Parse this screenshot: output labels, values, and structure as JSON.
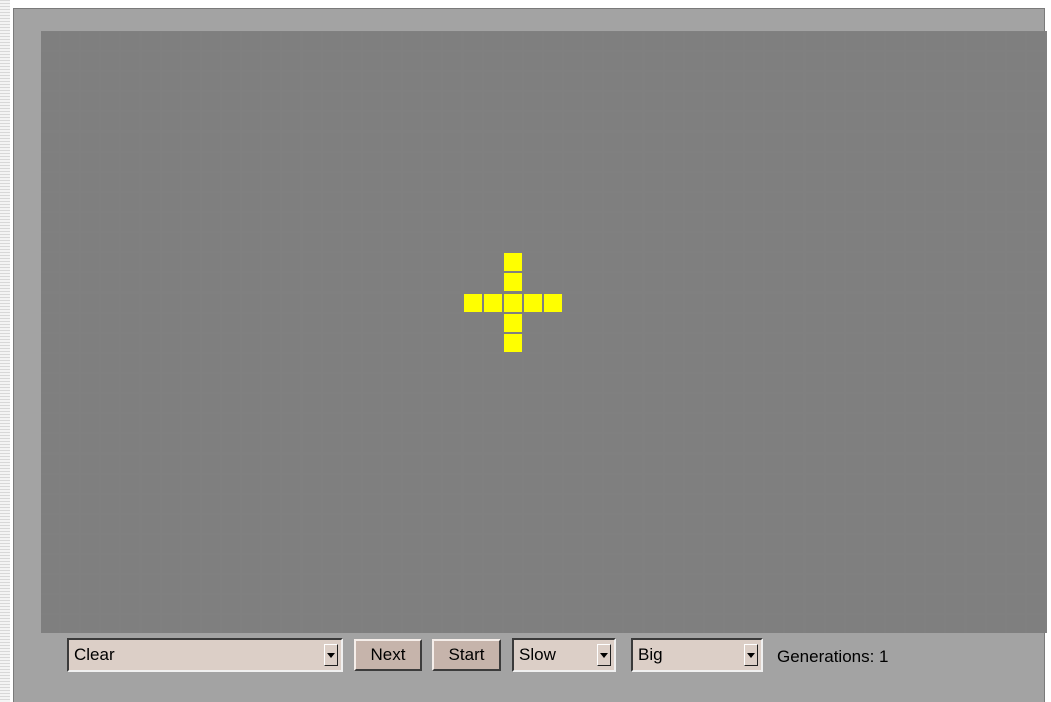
{
  "grid": {
    "columns": 50,
    "rows": 30,
    "alive_color": "#ffff00",
    "dead_color": "#7f7f7f",
    "alive_cells": [
      [
        23,
        11
      ],
      [
        23,
        12
      ],
      [
        21,
        13
      ],
      [
        22,
        13
      ],
      [
        23,
        13
      ],
      [
        24,
        13
      ],
      [
        25,
        13
      ],
      [
        23,
        14
      ],
      [
        23,
        15
      ]
    ]
  },
  "controls": {
    "pattern_select": "Clear",
    "next_label": "Next",
    "start_label": "Start",
    "speed_select": "Slow",
    "size_select": "Big",
    "generations_text": "Generations: 1"
  }
}
